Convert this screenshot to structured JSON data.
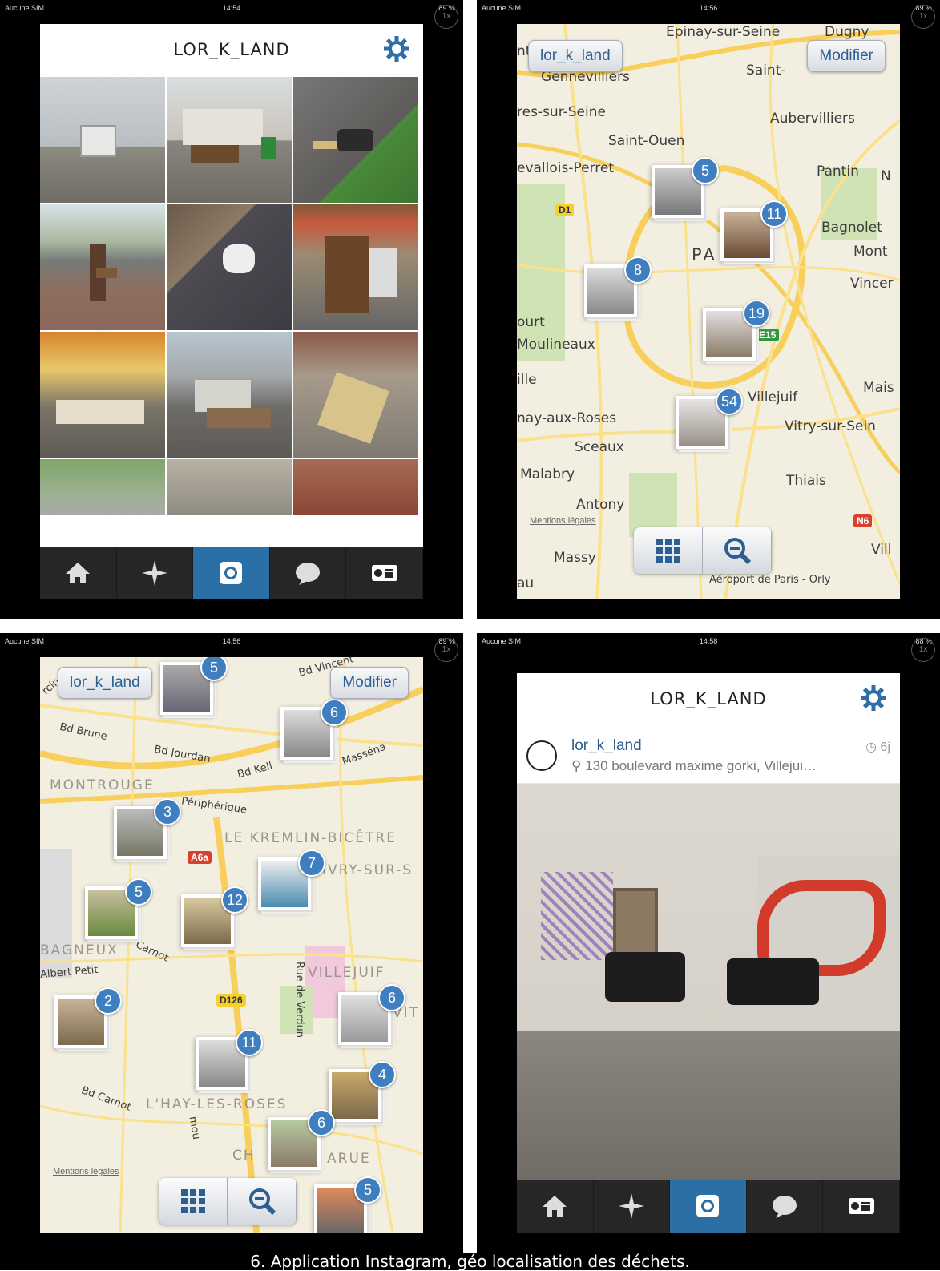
{
  "status_bar": {
    "carrier": "Aucune SIM",
    "time_1": "14:54",
    "time_2": "14:56",
    "time_3": "14:56",
    "time_4": "14:58",
    "battery_1": "89 %",
    "battery_2": "89 %",
    "battery_3": "89 %",
    "battery_4": "88 %",
    "zoom_badge": "1x"
  },
  "profile": {
    "title": "LOR_K_LAND",
    "settings_icon": "gear-icon"
  },
  "tabbar": {
    "items": [
      "home-icon",
      "explore-icon",
      "camera-icon",
      "news-icon",
      "profile-icon"
    ],
    "active": "camera-icon"
  },
  "map_view": {
    "back_label": "lor_k_land",
    "edit_label": "Modifier",
    "grid_icon": "grid-icon",
    "zoom_out_icon": "zoom-out-icon",
    "legal": "Mentions légales"
  },
  "map_paris": {
    "places": [
      "Epinay-sur-Seine",
      "Dugny",
      "Gennevilliers",
      "Saint-",
      "res-sur-Seine",
      "Aubervilliers",
      "Saint-Ouen",
      "evallois-Perret",
      "Pantin",
      "N",
      "Bagnolet",
      "Mont",
      "Vincer",
      "PA",
      "ourt",
      "Moulineaux",
      "ille",
      "Mais",
      "Villejuif",
      "nay-aux-Roses",
      "Vitry-sur-Sein",
      "Sceaux",
      "Malabry",
      "Thiais",
      "Antony",
      "Massy",
      "Vill",
      "au",
      "Aéroport de Paris - Orly",
      "nt"
    ],
    "shields": [
      "D1",
      "E15",
      "N6"
    ],
    "clusters": [
      5,
      11,
      8,
      19,
      54
    ]
  },
  "map_south": {
    "places": [
      "Bd Vincent",
      "Bd Brune",
      "Bd Jourdan",
      "Bd Kell",
      "Masséna",
      "MONTROUGE",
      "Périphérique",
      "LE KREMLIN-BICÊTRE",
      "IVRY-SUR-S",
      "BAGNEUX",
      "Carnot",
      "Albert Petit",
      "VILLEJUIF",
      "VIT",
      "Rue de Verdun",
      "Bd Carnot",
      "L'HAY-LES-ROSES",
      "CH",
      "ARUE",
      "rcingé",
      "mou"
    ],
    "shields": [
      "A6a",
      "D126"
    ],
    "clusters": [
      5,
      6,
      3,
      7,
      5,
      12,
      2,
      6,
      11,
      4,
      6,
      5
    ]
  },
  "post": {
    "title": "LOR_K_LAND",
    "username": "lor_k_land",
    "location": "130 boulevard maxime gorki, Villejui…",
    "age": "6j",
    "location_icon": "pin-icon",
    "clock_icon": "clock-icon"
  },
  "caption": "6. Application Instagram, géo localisation des déchets."
}
